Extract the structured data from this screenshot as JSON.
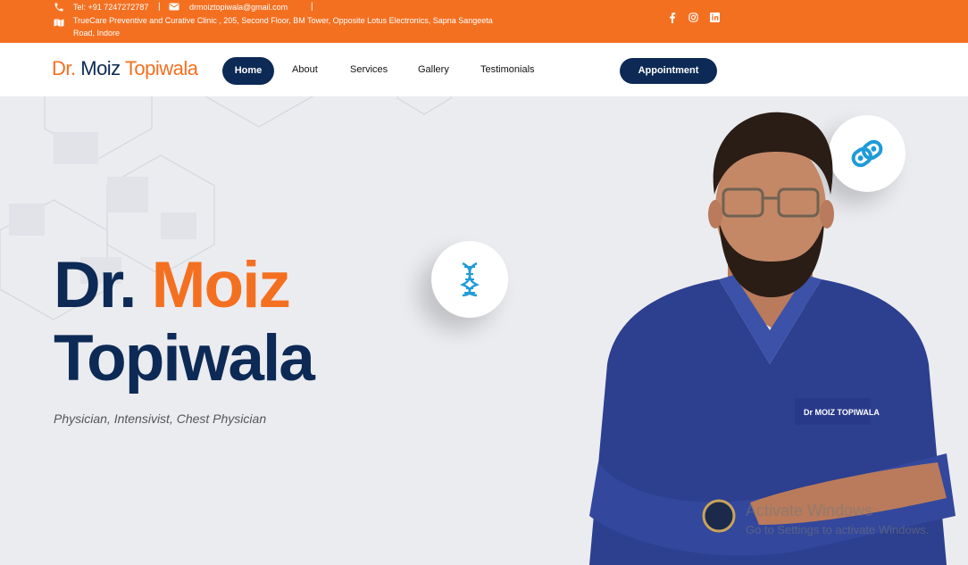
{
  "topbar": {
    "phone": "Tel: +91 7247272787",
    "separator": "|",
    "email": "drmoiztopiwala@gmail.com",
    "address": "TrueCare Preventive and Curative Clinic , 205, Second Floor, BM Tower, Opposite Lotus Electronics, Sapna Sangeeta Road, Indore",
    "icons": [
      "phone-icon",
      "mail-icon",
      "map-icon",
      "facebook-icon",
      "instagram-icon",
      "linkedin-icon"
    ],
    "color": "#f47021"
  },
  "navbar": {
    "logo": {
      "part1": "Dr.",
      "part2": " Moiz ",
      "part3": "Topiwala"
    },
    "links": [
      "Home",
      "About",
      "Services",
      "Gallery",
      "Testimonials"
    ],
    "active": "Home",
    "cta": "Appointment",
    "accent": "#0c2a55"
  },
  "hero": {
    "title_dr": "Dr. ",
    "title_moiz": "Moiz",
    "title_last": "Topiwala",
    "subtitle": "Physician, Intensivist, Chest Physician",
    "scrub_label": "Dr MOIZ TOPIWALA",
    "badges": [
      "dna-icon",
      "link-icon"
    ]
  },
  "watermark": {
    "line1": "Activate Windows",
    "line2": "Go to Settings to activate Windows."
  }
}
